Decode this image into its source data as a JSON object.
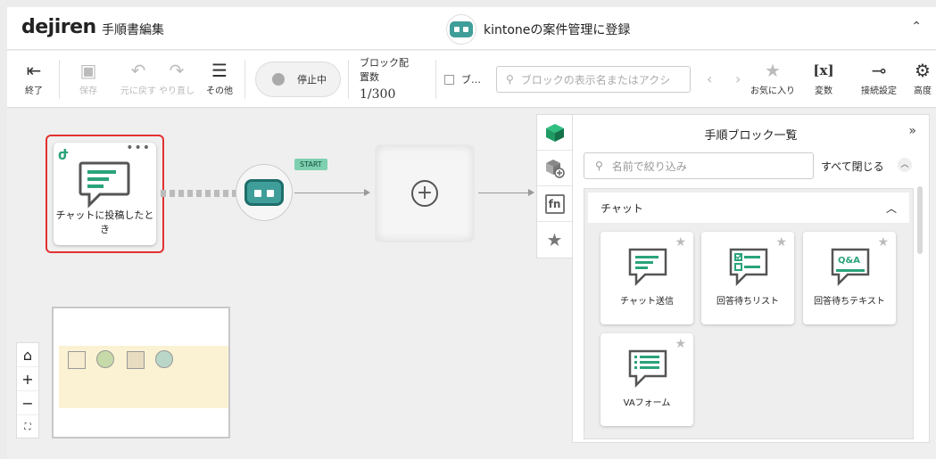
{
  "header": {
    "logo": "dejiren",
    "page_title": "手順書編集",
    "center_title": "kintoneの案件管理に登録",
    "collapse_icon": "chevron-double-up-icon"
  },
  "toolbar": {
    "exit_label": "終了",
    "save_label": "保存",
    "undo_label": "元に戻す",
    "redo_label": "やり直し",
    "other_label": "その他",
    "toggle_label": "停止中",
    "block_count_label": "ブロック配置数",
    "block_count_value": "1/300",
    "checkbox_label": "ブ…",
    "search_placeholder": "ブロックの表示名またはアクシ",
    "favorites_label": "お気に入り",
    "variables_label": "変数",
    "connection_label": "接続設定",
    "advanced_label": "高度"
  },
  "canvas": {
    "trigger_label": "チャットに投稿したとき",
    "start_tag": "START"
  },
  "side_tabs": [
    "cube-icon",
    "package-add-icon",
    "fn-icon",
    "star-icon"
  ],
  "panel": {
    "title": "手順ブロック一覧",
    "search_placeholder": "名前で絞り込み",
    "close_all": "すべて閉じる",
    "section": "チャット",
    "cards": [
      {
        "label": "チャット送信",
        "icon": "chat-send-icon"
      },
      {
        "label": "回答待ちリスト",
        "icon": "chat-list-icon"
      },
      {
        "label": "回答待ちテキスト",
        "icon": "chat-qa-icon",
        "badge": "Q&A"
      },
      {
        "label": "VAフォーム",
        "icon": "chat-form-icon"
      }
    ]
  },
  "colors": {
    "accent": "#3f9e99",
    "start_tag": "#7fd0b0",
    "selection": "#e23131",
    "icon_green": "#2aa37a"
  }
}
